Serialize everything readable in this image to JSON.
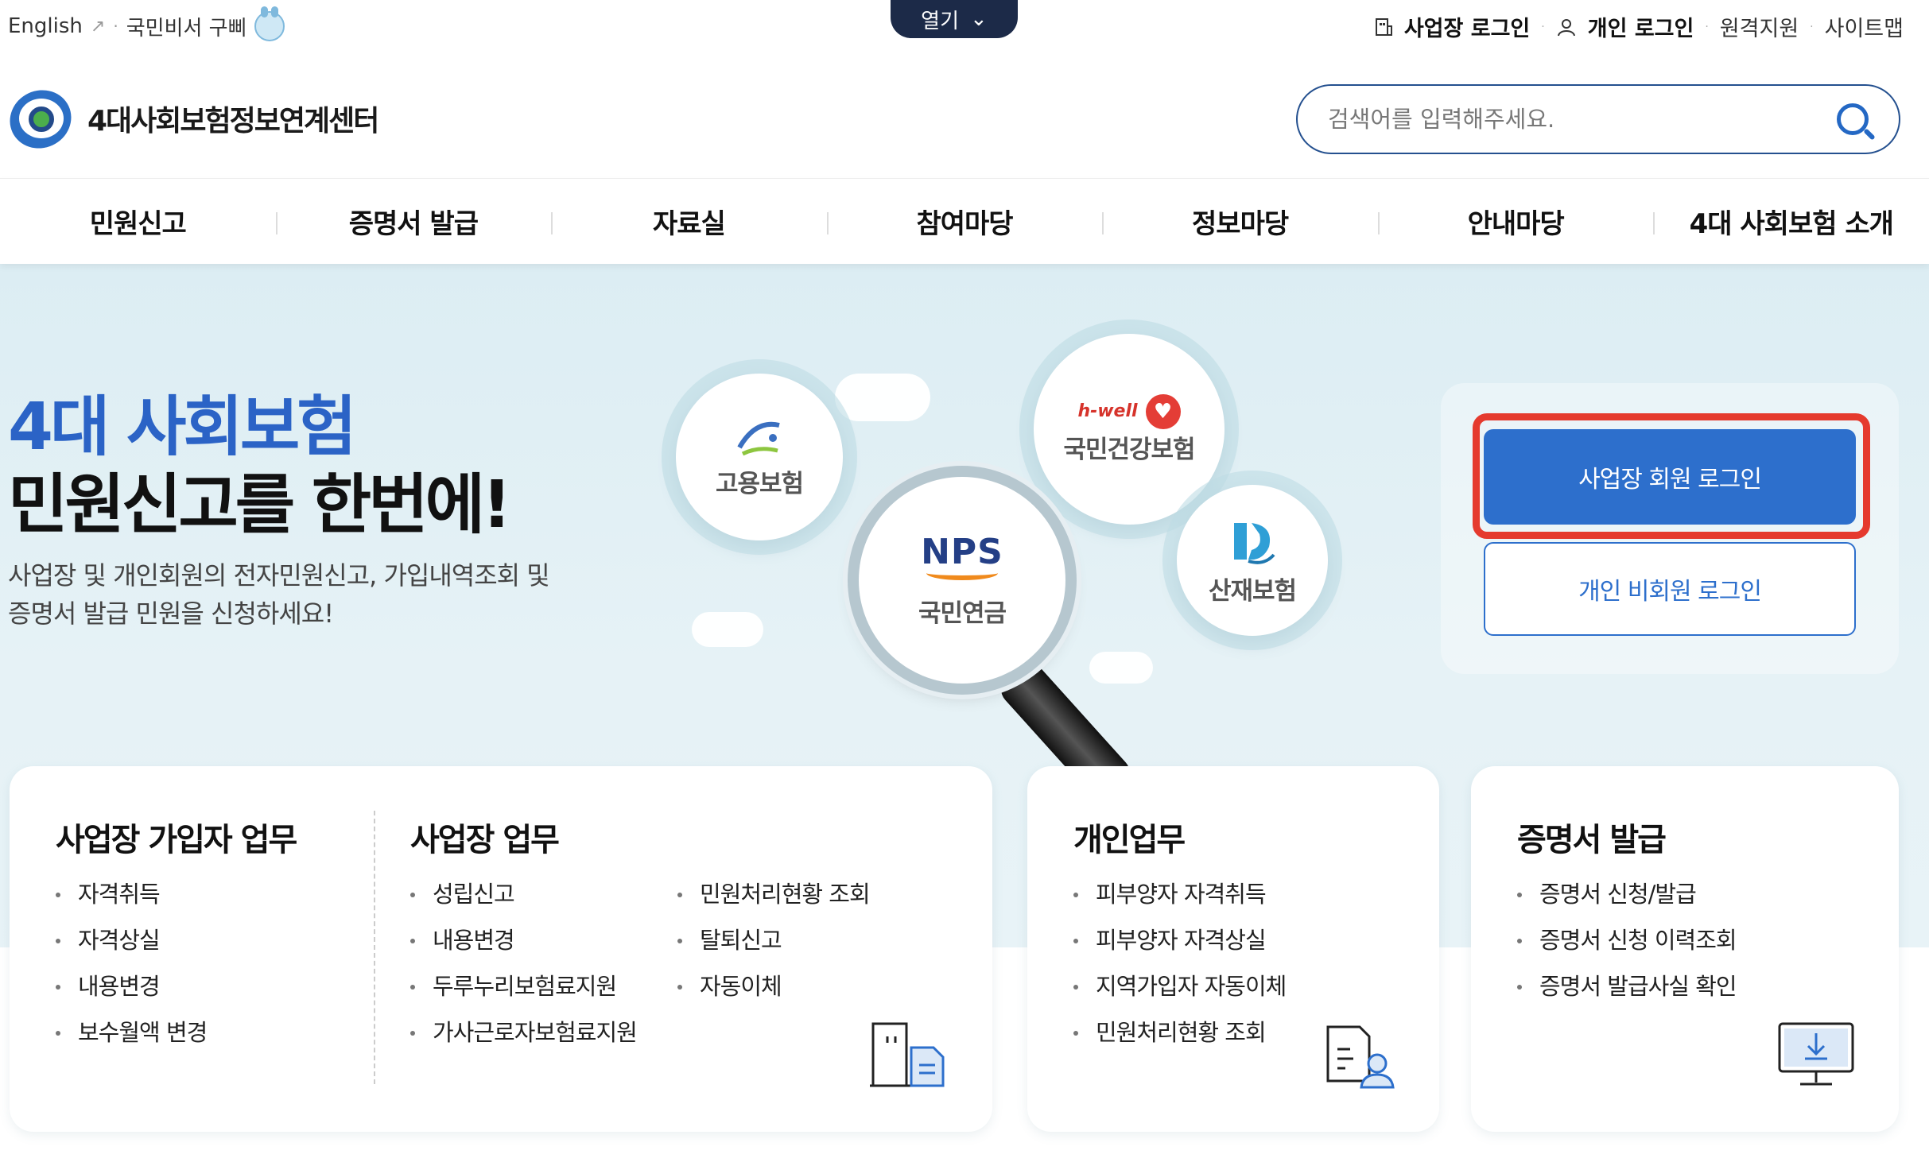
{
  "util": {
    "english": "English",
    "ext_icon": "↗",
    "sep": "·",
    "secretary": "국민비서 구삐",
    "open_tab": "열기",
    "open_chevron": "⌄",
    "biz_login": "사업장 로그인",
    "personal_login": "개인 로그인",
    "remote_support": "원격지원",
    "sitemap": "사이트맵",
    "building_icon": "building-icon",
    "person_icon": "person-icon"
  },
  "header": {
    "logo_text": "4대사회보험정보연계센터",
    "search_placeholder": "검색어를 입력해주세요."
  },
  "nav": [
    "민원신고",
    "증명서 발급",
    "자료실",
    "참여마당",
    "정보마당",
    "안내마당",
    "4대 사회보험 소개"
  ],
  "hero": {
    "title_line1": "4대 사회보험",
    "title_line2": "민원신고를 한번에!",
    "desc_line1": "사업장 및 개인회원의 전자민원신고, 가입내역조회 및",
    "desc_line2": "증명서 발급 민원을 신청하세요!",
    "bubbles": {
      "employment": "고용보험",
      "health_tag": "h-well",
      "health": "국민건강보험",
      "pension_logo": "NPS",
      "pension": "국민연금",
      "industrial": "산재보험"
    }
  },
  "login": {
    "biz_button": "사업장 회원 로그인",
    "individual_button": "개인 비회원 로그인",
    "highlight_color": "#e53a2e",
    "primary_color": "#2d6fcc"
  },
  "cards": {
    "biz_member": {
      "title": "사업장 가입자 업무",
      "items": [
        "자격취득",
        "자격상실",
        "내용변경",
        "보수월액 변경"
      ]
    },
    "biz": {
      "title": "사업장 업무",
      "items_left": [
        "성립신고",
        "내용변경",
        "두루누리보험료지원",
        "가사근로자보험료지원"
      ],
      "items_right": [
        "민원처리현황 조회",
        "탈퇴신고",
        "자동이체"
      ]
    },
    "personal": {
      "title": "개인업무",
      "items": [
        "피부양자 자격취득",
        "피부양자 자격상실",
        "지역가입자 자동이체",
        "민원처리현황 조회"
      ]
    },
    "cert": {
      "title": "증명서 발급",
      "items": [
        "증명서 신청/발급",
        "증명서 신청 이력조회",
        "증명서 발급사실 확인"
      ]
    }
  }
}
